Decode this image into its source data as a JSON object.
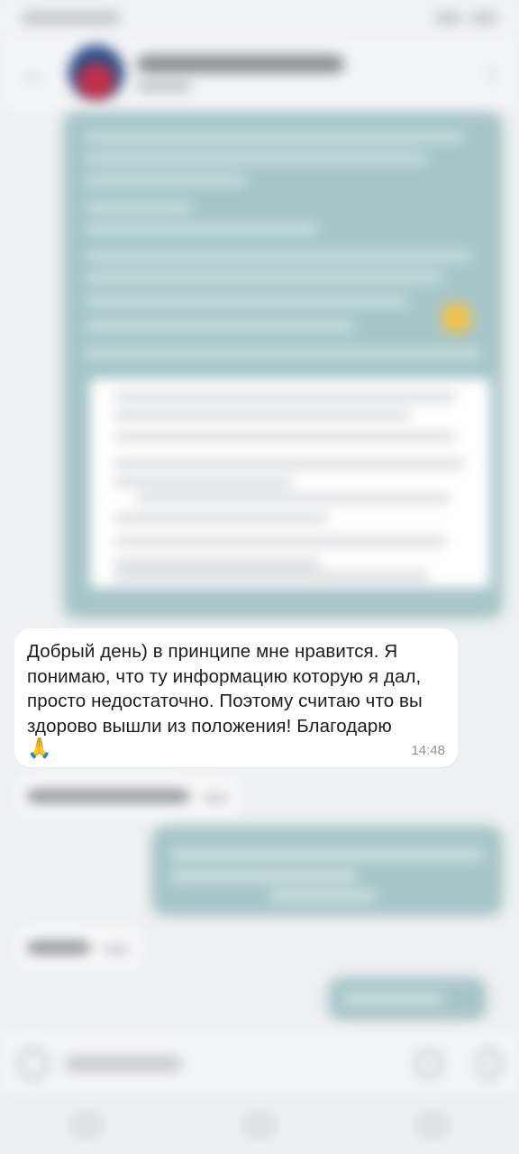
{
  "header": {
    "back_icon": "back-arrow-icon",
    "more_icon": "more-vertical-icon"
  },
  "message": {
    "text": "Добрый день) в принципе мне нравится. Я понимаю, что ту информацию которую я дал, просто недостаточно. Поэтому считаю что вы здорово вышли из положения! Благодарю",
    "emoji": "🙏",
    "time": "14:48"
  },
  "input": {
    "attach_icon": "attach-icon",
    "sticker_icon": "sticker-icon",
    "mic_icon": "microphone-icon"
  },
  "nav": {
    "icons": [
      "recent-apps-icon",
      "home-icon",
      "back-nav-icon"
    ]
  }
}
